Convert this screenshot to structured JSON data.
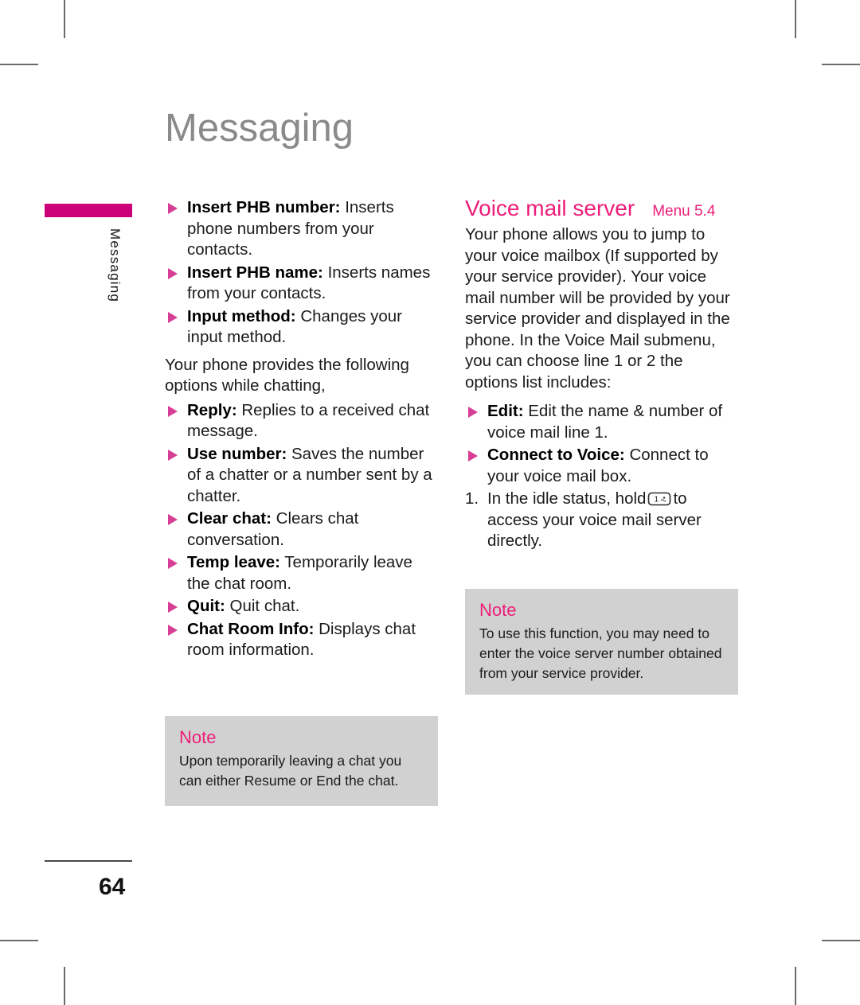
{
  "page": {
    "title": "Messaging",
    "side_tab_label": "Messaging",
    "number": "64"
  },
  "left_column": {
    "bullets_top": [
      {
        "term": "Insert PHB number:",
        "desc": " Inserts phone numbers from your contacts."
      },
      {
        "term": "Insert PHB name:",
        "desc": " Inserts names from your contacts."
      },
      {
        "term": "Input method:",
        "desc": " Changes your input method."
      }
    ],
    "intro_paragraph": "Your phone provides the following options while chatting,",
    "bullets_bottom": [
      {
        "term": "Reply:",
        "desc": " Replies to a received chat message."
      },
      {
        "term": "Use number:",
        "desc": " Saves the number of a chatter or a number sent by a chatter."
      },
      {
        "term": "Clear chat:",
        "desc": " Clears chat conversation."
      },
      {
        "term": "Temp leave:",
        "desc": " Temporarily leave the chat room."
      },
      {
        "term": "Quit:",
        "desc": " Quit chat."
      },
      {
        "term": "Chat Room Info:",
        "desc": " Displays chat room information."
      }
    ],
    "note": {
      "title": "Note",
      "body": "Upon temporarily leaving a chat you can either Resume or End the chat."
    }
  },
  "right_column": {
    "heading": {
      "title": "Voice mail server",
      "menu": "Menu 5.4"
    },
    "intro_paragraph": "Your phone allows you to jump to your voice mailbox (If supported by your service provider). Your voice mail number will be provided by your service provider and displayed in the phone. In the Voice Mail submenu, you can choose line 1 or 2 the options list includes:",
    "bullets": [
      {
        "term": "Edit:",
        "desc": " Edit the name & number of voice mail line 1."
      },
      {
        "term": "Connect to Voice:",
        "desc": " Connect to your voice mail box."
      }
    ],
    "numbered_step": {
      "number": "1.",
      "text_before": "In the idle status, hold",
      "key_label": "1",
      "text_after": "to access your voice mail server directly."
    },
    "note": {
      "title": "Note",
      "body": "To use this function, you may need to enter the voice server number obtained from your service provider."
    }
  },
  "colors": {
    "accent_pink": "#ed1e79",
    "tab_magenta": "#cc0077",
    "bullet_pink": "#d63f95",
    "note_bg": "#d1d1d1",
    "title_gray": "#8a8a8a"
  }
}
